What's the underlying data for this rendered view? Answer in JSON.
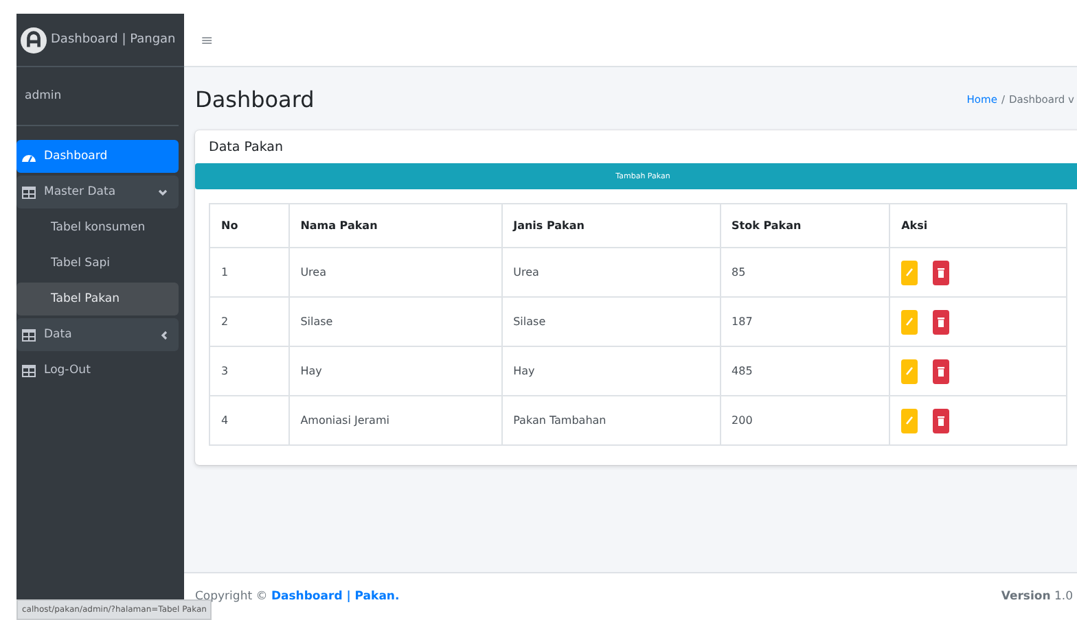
{
  "sidebar": {
    "brand": "Dashboard | Pangan",
    "user": "admin",
    "items": [
      {
        "label": "Dashboard",
        "kind": "gauge",
        "selected": true
      },
      {
        "label": "Master Data",
        "kind": "table",
        "selected": false,
        "expanded": true,
        "children": [
          {
            "label": "Tabel konsumen",
            "selected": false
          },
          {
            "label": "Tabel Sapi",
            "selected": false
          },
          {
            "label": "Tabel Pakan",
            "selected": true
          }
        ]
      },
      {
        "label": "Data",
        "kind": "table",
        "selected": false,
        "expanded": false
      },
      {
        "label": "Log-Out",
        "kind": "table",
        "selected": false
      }
    ]
  },
  "navbar": {
    "menu_toggle": "≡"
  },
  "header": {
    "title": "Dashboard",
    "breadcrumb": [
      {
        "label": "Home",
        "link": true
      },
      {
        "label": "Dashboard v",
        "link": false
      }
    ],
    "breadcrumb_separator": "/"
  },
  "card": {
    "title": "Data Pakan",
    "add_button": "Tambah Pakan",
    "table": {
      "columns": [
        "No",
        "Nama Pakan",
        "Janis Pakan",
        "Stok Pakan",
        "Aksi"
      ],
      "rows": [
        [
          "1",
          "Urea",
          "Urea",
          "85"
        ],
        [
          "2",
          "Silase",
          "Silase",
          "187"
        ],
        [
          "3",
          "Hay",
          "Hay",
          "485"
        ],
        [
          "4",
          "Amoniasi Jerami",
          "Pakan Tambahan",
          "200"
        ]
      ]
    }
  },
  "footer": {
    "copyright": "Copyright © **Dashboard | Pakan.**",
    "version_label": "Version",
    "version": "1.0"
  },
  "status_url": "calhost/pakan/admin/?halaman=Tabel Pakan"
}
